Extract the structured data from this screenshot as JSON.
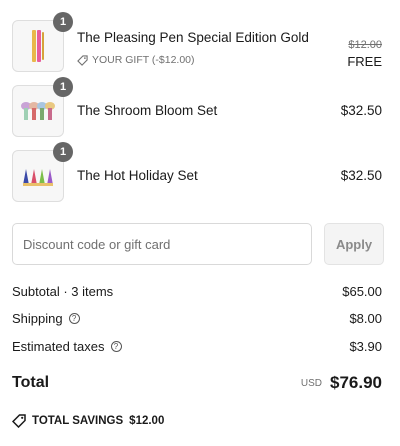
{
  "items": [
    {
      "name": "The Pleasing Pen Special Edition Gold",
      "quantity": "1",
      "gift_label": "YOUR GIFT (-$12.00)",
      "original_price": "$12.00",
      "price": "FREE",
      "image_icon": "pen-product-image"
    },
    {
      "name": "The Shroom Bloom Set",
      "quantity": "1",
      "price": "$32.50",
      "image_icon": "mushroom-set-product-image"
    },
    {
      "name": "The Hot Holiday Set",
      "quantity": "1",
      "price": "$32.50",
      "image_icon": "holiday-set-product-image"
    }
  ],
  "discount": {
    "placeholder": "Discount code or gift card",
    "apply_label": "Apply"
  },
  "summary": {
    "subtotal_label": "Subtotal · 3 items",
    "subtotal_value": "$65.00",
    "shipping_label": "Shipping",
    "shipping_value": "$8.00",
    "taxes_label": "Estimated taxes",
    "taxes_value": "$3.90"
  },
  "total": {
    "label": "Total",
    "currency": "USD",
    "value": "$76.90"
  },
  "savings": {
    "label": "TOTAL SAVINGS",
    "value": "$12.00"
  },
  "colors": {
    "badge": "#666666",
    "text": "#1a1a1a",
    "muted": "#707070",
    "pen_gold": "#e9b84a",
    "pen_pink": "#e85d9b"
  }
}
